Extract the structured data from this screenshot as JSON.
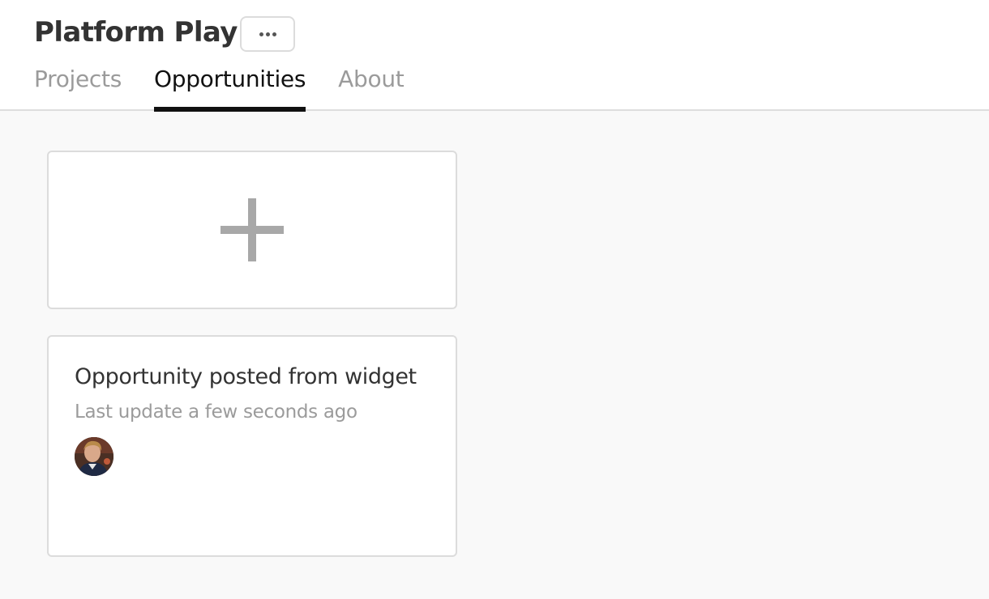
{
  "header": {
    "title": "Platform Play",
    "more_button_icon": "ellipsis-icon"
  },
  "tabs": [
    {
      "label": "Projects",
      "active": false
    },
    {
      "label": "Opportunities",
      "active": true
    },
    {
      "label": "About",
      "active": false
    }
  ],
  "add_card": {
    "icon": "plus-icon"
  },
  "opportunities": [
    {
      "title": "Opportunity posted from widget",
      "last_update": "Last update a few seconds ago",
      "avatar_icon": "user-avatar"
    }
  ],
  "colors": {
    "active_tab": "#111111",
    "inactive_tab": "#9b9b9b",
    "page_background": "#f9f9f9",
    "card_border": "#dcdcdc",
    "plus_icon": "#a8a8a8"
  }
}
